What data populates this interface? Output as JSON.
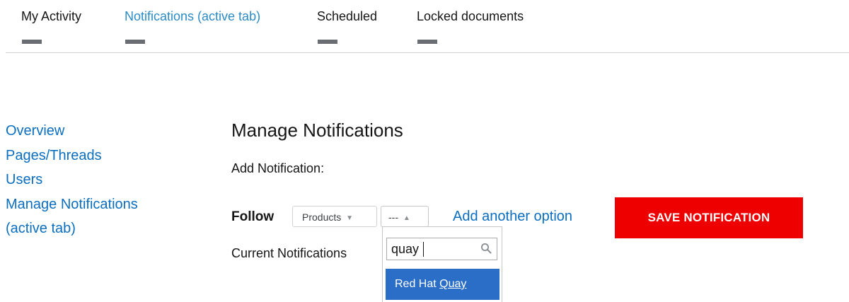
{
  "tabs": [
    {
      "label": "My Activity",
      "active": false
    },
    {
      "label": "Notifications (active tab)",
      "active": true
    },
    {
      "label": "Scheduled",
      "active": false
    },
    {
      "label": "Locked documents",
      "active": false
    }
  ],
  "sidebar": {
    "items": [
      {
        "label": "Overview"
      },
      {
        "label": "Pages/Threads"
      },
      {
        "label": "Users"
      },
      {
        "label": "Manage Notifications"
      },
      {
        "label": "(active tab)"
      }
    ]
  },
  "main": {
    "title": "Manage Notifications",
    "add_label": "Add Notification:",
    "follow_label": "Follow",
    "products_select": {
      "value": "Products",
      "icon": "caret-down-icon"
    },
    "type_select": {
      "value": "---",
      "icon": "caret-up-icon"
    },
    "add_option_label": "Add another option",
    "save_label": "SAVE NOTIFICATION",
    "current_label": "Current Notifications"
  },
  "dropdown": {
    "search_value": "quay",
    "search_icon": "search-icon",
    "option_prefix": "Red Hat ",
    "option_match": "Quay"
  },
  "colors": {
    "link": "#0b6ebf",
    "active_tab": "#2b8bc6",
    "save_button": "#ee0000",
    "option_highlight": "#2a6ec8"
  }
}
